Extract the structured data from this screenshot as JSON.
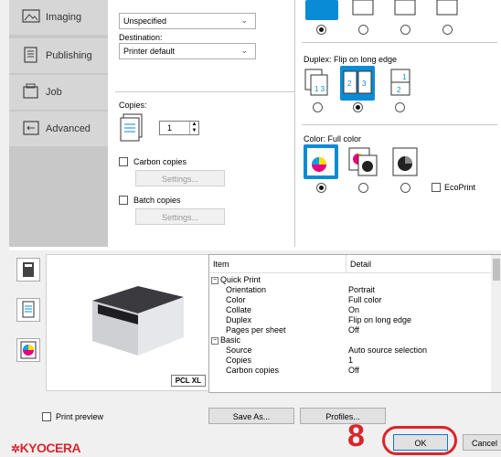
{
  "sidebar": {
    "items": [
      {
        "label": "Imaging",
        "icon": "image-icon"
      },
      {
        "label": "Publishing",
        "icon": "publishing-icon"
      },
      {
        "label": "Job",
        "icon": "job-icon"
      },
      {
        "label": "Advanced",
        "icon": "advanced-icon"
      }
    ]
  },
  "middle": {
    "unspecified_value": "Unspecified",
    "destination_label": "Destination:",
    "destination_value": "Printer default",
    "copies_label": "Copies:",
    "copies_value": "1",
    "carbon_label": "Carbon copies",
    "carbon_settings": "Settings...",
    "batch_label": "Batch copies",
    "batch_settings": "Settings..."
  },
  "right": {
    "duplex_label": "Duplex: Flip on long edge",
    "color_label": "Color: Full color",
    "ecoprint_label": "EcoPrint"
  },
  "preview": {
    "pdl_badge": "PCL XL"
  },
  "table": {
    "headers": [
      "Item",
      "Detail"
    ],
    "rows": [
      {
        "k": "Quick Print",
        "v": "",
        "group": true
      },
      {
        "k": "Orientation",
        "v": "Portrait"
      },
      {
        "k": "Color",
        "v": "Full color"
      },
      {
        "k": "Collate",
        "v": "On"
      },
      {
        "k": "Duplex",
        "v": "Flip on long edge"
      },
      {
        "k": "Pages per sheet",
        "v": "Off"
      },
      {
        "k": "Basic",
        "v": "",
        "group": true
      },
      {
        "k": "Source",
        "v": "Auto source selection"
      },
      {
        "k": "Copies",
        "v": "1"
      },
      {
        "k": "Carbon copies",
        "v": "Off"
      }
    ]
  },
  "footer": {
    "print_preview": "Print preview",
    "save_as": "Save As...",
    "profiles": "Profiles...",
    "ok": "OK",
    "cancel": "Cancel",
    "brand": "KYOCERA",
    "step_number": "8"
  },
  "colors": {
    "accent": "#0a8bd6",
    "highlight_ring": "#d9262b",
    "brand": "#d9262b"
  }
}
